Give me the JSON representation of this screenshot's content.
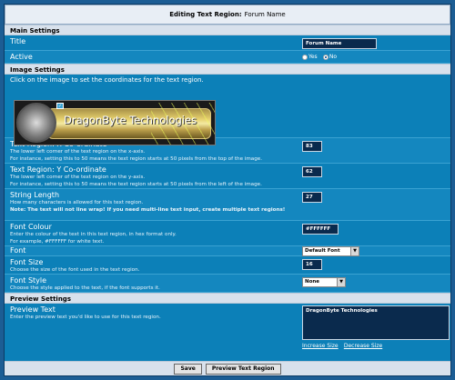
{
  "header": {
    "title": "Editing Text Region:",
    "subtitle": "Forum Name"
  },
  "sections": {
    "main": "Main Settings",
    "image": "Image Settings",
    "preview": "Preview Settings"
  },
  "title_field": {
    "label": "Title",
    "value": "Forum Name"
  },
  "active": {
    "label": "Active",
    "yes": "Yes",
    "no": "No",
    "selected": "no"
  },
  "image": {
    "instruction": "Click on the image to set the coordinates for the text region.",
    "banner_text": "DragonByte Technologies"
  },
  "x_coord": {
    "label": "Text Region: X Co-ordinate",
    "desc1": "The lower left corner of the text region on the x-axis.",
    "desc2": "For instance, setting this to 50 means the text region starts at 50 pixels from the top of the image.",
    "value": "83"
  },
  "y_coord": {
    "label": "Text Region: Y Co-ordinate",
    "desc1": "The lower left corner of the text region on the y-axis.",
    "desc2": "For instance, setting this to 50 means the text region starts at 50 pixels from the left of the image.",
    "value": "62"
  },
  "string_length": {
    "label": "String Length",
    "desc1": "How many characters is allowed for this text region.",
    "note": "Note: The text will not line wrap! If you need multi-line text input, create multiple text regions!",
    "value": "27"
  },
  "font_colour": {
    "label": "Font Colour",
    "desc1": "Enter the colour of the text in this text region, in hex format only.",
    "desc2": "For example, #FFFFFF for white text.",
    "value": "#FFFFFF"
  },
  "font": {
    "label": "Font",
    "value": "Default Font"
  },
  "font_size": {
    "label": "Font Size",
    "desc1": "Choose the size of the font used in the text region.",
    "value": "16"
  },
  "font_style": {
    "label": "Font Style",
    "desc1": "Choose the style applied to the text, if the font supports it.",
    "value": "None"
  },
  "preview_text": {
    "label": "Preview Text",
    "desc1": "Enter the preview text you'd like to use for this text region.",
    "value": "DragonByte Technologies",
    "increase": "Increase Size",
    "decrease": "Decrease Size"
  },
  "buttons": {
    "save": "Save",
    "preview": "Preview Text Region"
  }
}
